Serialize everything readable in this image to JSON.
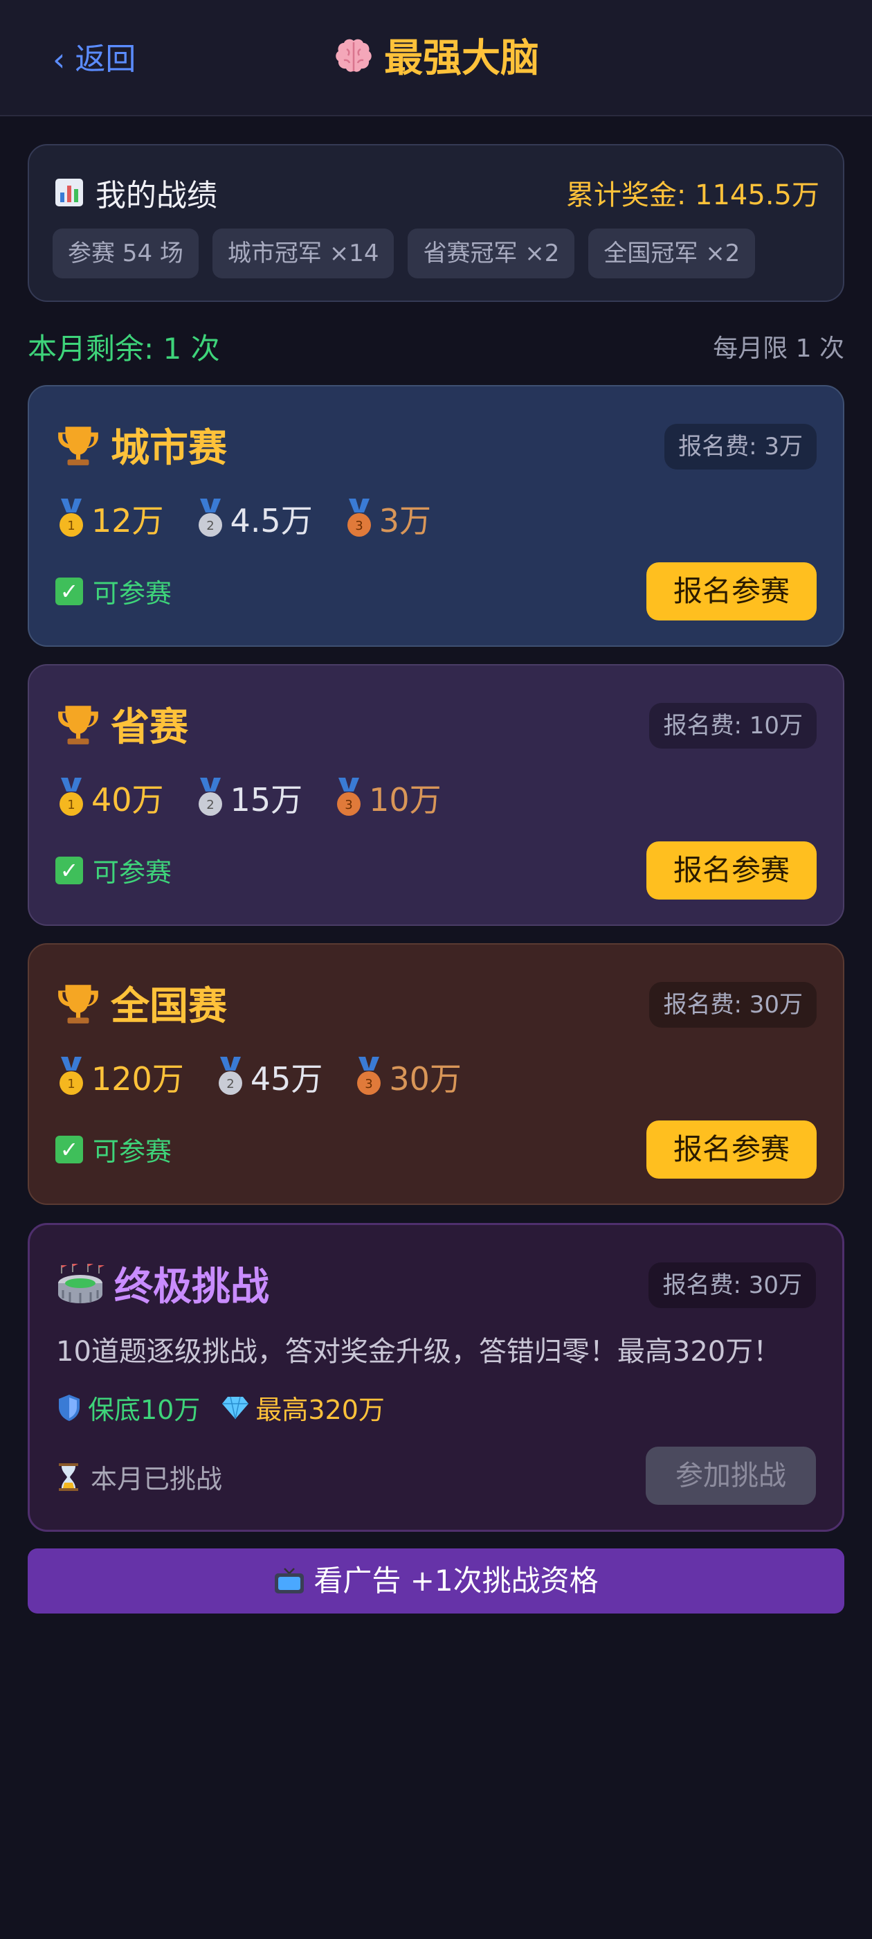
{
  "header": {
    "back_label": "返回",
    "title": "最强大脑"
  },
  "stats": {
    "label": "我的战绩",
    "total_prize": "累计奖金: 1145.5万",
    "chips": [
      "参赛 54 场",
      "城市冠军 ×14",
      "省赛冠军 ×2",
      "全国冠军 ×2"
    ]
  },
  "quota": {
    "remaining": "本月剩余: 1 次",
    "limit": "每月限 1 次"
  },
  "contests": [
    {
      "name": "城市赛",
      "fee": "报名费: 3万",
      "gold": "12万",
      "silver": "4.5万",
      "bronze": "3万",
      "status": "可参赛",
      "button": "报名参赛"
    },
    {
      "name": "省赛",
      "fee": "报名费: 10万",
      "gold": "40万",
      "silver": "15万",
      "bronze": "10万",
      "status": "可参赛",
      "button": "报名参赛"
    },
    {
      "name": "全国赛",
      "fee": "报名费: 30万",
      "gold": "120万",
      "silver": "45万",
      "bronze": "30万",
      "status": "可参赛",
      "button": "报名参赛"
    }
  ],
  "ultimate": {
    "name": "终极挑战",
    "fee": "报名费: 30万",
    "description": "10道题逐级挑战，答对奖金升级，答错归零！最高320万！",
    "guarantee": "保底10万",
    "max": "最高320万",
    "status": "本月已挑战",
    "button": "参加挑战"
  },
  "ad": {
    "label": "看广告 +1次挑战资格"
  },
  "icons": {
    "back": "chevron-left-icon",
    "title": "brain-icon",
    "stats": "bar-chart-icon",
    "trophy": "trophy-icon",
    "gold": "gold-medal-icon",
    "silver": "silver-medal-icon",
    "bronze": "bronze-medal-icon",
    "check": "check-icon",
    "stadium": "stadium-icon",
    "shield": "shield-icon",
    "diamond": "diamond-icon",
    "hourglass": "hourglass-icon",
    "tv": "tv-icon"
  },
  "colors": {
    "accent": "#ffc23a",
    "success": "#3ed47a",
    "link": "#5b8cff",
    "purple": "#c98cff",
    "ad": "#6633a8"
  }
}
